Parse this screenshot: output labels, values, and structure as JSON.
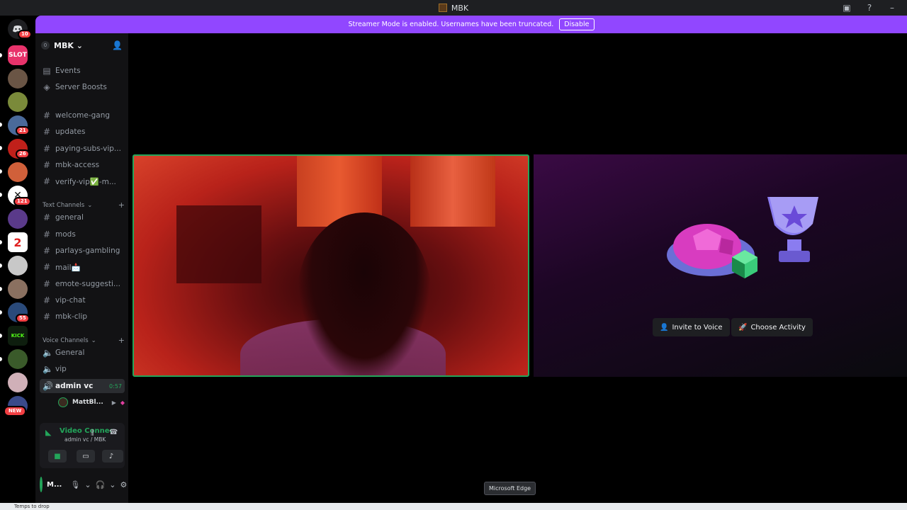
{
  "window": {
    "title": "MBK"
  },
  "banner": {
    "text": "Streamer Mode is enabled. Usernames have been truncated.",
    "button": "Disable",
    "color": "#9147ff"
  },
  "rail": {
    "dm_badge": "10",
    "servers": [
      {
        "label": "SLOT",
        "color": "#e8336b"
      },
      {
        "badge": "21"
      },
      {
        "badge": "26"
      },
      {
        "badge": "121"
      },
      {
        "label": "2"
      },
      {
        "badge": "55"
      },
      {
        "label": "KICK"
      },
      {
        "badge": "NEW"
      }
    ]
  },
  "server": {
    "name": "MBK"
  },
  "sidebar": {
    "top_items": [
      {
        "label": "Events",
        "icon": "calendar-icon"
      },
      {
        "label": "Server Boosts",
        "icon": "boost-icon"
      }
    ],
    "channels": [
      "welcome-gang",
      "updates",
      "paying-subs-vip...",
      "mbk-access",
      "verify-vip✅-m..."
    ],
    "text_category": "Text Channels",
    "text_channels": [
      "general",
      "mods",
      "parlays-gambling",
      "mail📩",
      "emote-suggesti...",
      "vip-chat",
      "mbk-clip"
    ],
    "voice_category": "Voice Channels",
    "voice_channels": [
      {
        "label": "General"
      },
      {
        "label": "vip"
      },
      {
        "label": "admin vc",
        "timer": "0:57",
        "active": true
      }
    ],
    "voice_user": "MattBl..."
  },
  "voice_panel": {
    "status": "Video Connected",
    "sub": "admin vc / MBK"
  },
  "user_panel": {
    "name": "M..."
  },
  "activity": {
    "invite_label": "Invite to Voice",
    "choose_label": "Choose Activity"
  },
  "tooltip": "Microsoft Edge",
  "taskbar": {
    "weather": "Temps to drop"
  },
  "colors": {
    "accent_green": "#23a55a",
    "sidebar_bg": "#121214"
  }
}
